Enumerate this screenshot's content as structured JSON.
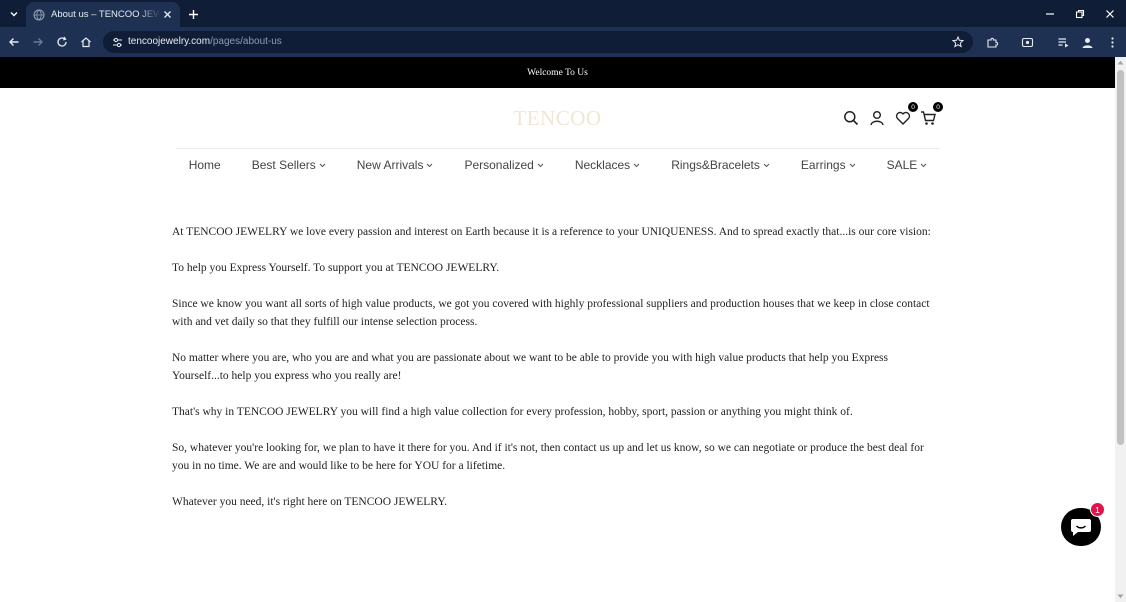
{
  "browser": {
    "tab_title": "About us – TENCOO JEWELRY",
    "url_host": "tencoojewelry.com",
    "url_path": "/pages/about-us"
  },
  "announcement": "Welcome To Us",
  "header": {
    "logo": "TENCOO",
    "wishlist_count": "0",
    "cart_count": "0"
  },
  "nav": {
    "items": [
      {
        "label": "Home",
        "dropdown": false
      },
      {
        "label": "Best Sellers",
        "dropdown": true
      },
      {
        "label": "New Arrivals",
        "dropdown": true
      },
      {
        "label": "Personalized",
        "dropdown": true
      },
      {
        "label": "Necklaces",
        "dropdown": true
      },
      {
        "label": "Rings&Bracelets",
        "dropdown": true
      },
      {
        "label": "Earrings",
        "dropdown": true
      },
      {
        "label": "SALE",
        "dropdown": true
      }
    ]
  },
  "content": {
    "paragraphs": [
      "At TENCOO JEWELRY we love every passion and interest on Earth because it is a reference to your UNIQUENESS. And to spread exactly that...is our core vision:",
      "To help you Express Yourself. To support you at TENCOO JEWELRY.",
      "Since we know you want all sorts of high value products, we got you covered with highly professional suppliers and production houses that we keep in close contact with and vet daily so that they fulfill our intense selection process.",
      "No matter where you are, who you are and what you are passionate about we want to be able to provide you with high value products that help you Express Yourself...to help you express who you really are!",
      "That's why in TENCOO JEWELRY you will find a high value collection for every profession, hobby, sport, passion or anything you might think of.",
      "So, whatever you're looking for, we plan to have it there for you. And if it's not, then contact us up and let us know, so we can negotiate or produce the best deal for you in no time. We are and would like to be here for YOU for a lifetime.",
      "Whatever you need, it's right here on TENCOO JEWELRY."
    ]
  },
  "chat": {
    "unread_count": "1"
  },
  "colors": {
    "chrome_dark": "#0f1d36",
    "chrome_toolbar": "#1e3152",
    "announcement_bg": "#000000",
    "logo": "#efe7d3",
    "chat_badge": "#e0144c"
  }
}
